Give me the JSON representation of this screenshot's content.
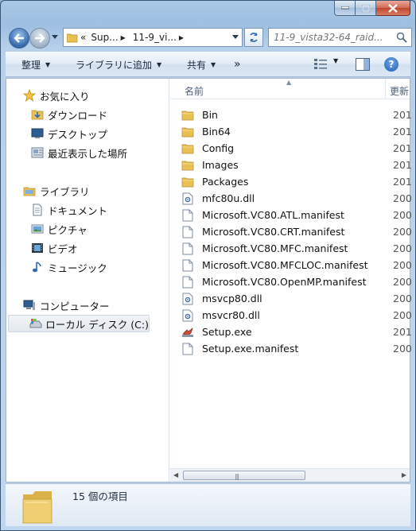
{
  "window": {
    "caption": {
      "minimize": "minimize",
      "maximize": "maximize",
      "close": "close"
    }
  },
  "address": {
    "overflow": "«",
    "segments": [
      "Sup...",
      "11-9_vi..."
    ]
  },
  "search": {
    "placeholder": "11-9_vista32-64_raid..."
  },
  "toolbar": {
    "organize": "整理",
    "add_to_library": "ライブラリに追加",
    "share": "共有",
    "more": "»"
  },
  "navigation": {
    "favorites": {
      "label": "お気に入り",
      "items": [
        "ダウンロード",
        "デスクトップ",
        "最近表示した場所"
      ]
    },
    "libraries": {
      "label": "ライブラリ",
      "items": [
        "ドキュメント",
        "ピクチャ",
        "ビデオ",
        "ミュージック"
      ]
    },
    "computer": {
      "label": "コンピューター",
      "items": [
        "ローカル ディスク (C:)"
      ]
    }
  },
  "columns": {
    "name": "名前",
    "date": "更新"
  },
  "files": [
    {
      "name": "Bin",
      "type": "folder",
      "date": "201"
    },
    {
      "name": "Bin64",
      "type": "folder",
      "date": "201"
    },
    {
      "name": "Config",
      "type": "folder",
      "date": "201"
    },
    {
      "name": "Images",
      "type": "folder",
      "date": "201"
    },
    {
      "name": "Packages",
      "type": "folder",
      "date": "201"
    },
    {
      "name": "mfc80u.dll",
      "type": "dll",
      "date": "200"
    },
    {
      "name": "Microsoft.VC80.ATL.manifest",
      "type": "file",
      "date": "200"
    },
    {
      "name": "Microsoft.VC80.CRT.manifest",
      "type": "file",
      "date": "200"
    },
    {
      "name": "Microsoft.VC80.MFC.manifest",
      "type": "file",
      "date": "200"
    },
    {
      "name": "Microsoft.VC80.MFCLOC.manifest",
      "type": "file",
      "date": "200"
    },
    {
      "name": "Microsoft.VC80.OpenMP.manifest",
      "type": "file",
      "date": "200"
    },
    {
      "name": "msvcp80.dll",
      "type": "dll",
      "date": "200"
    },
    {
      "name": "msvcr80.dll",
      "type": "dll",
      "date": "200"
    },
    {
      "name": "Setup.exe",
      "type": "exe",
      "date": "201"
    },
    {
      "name": "Setup.exe.manifest",
      "type": "file",
      "date": "200"
    }
  ],
  "status": {
    "item_count": "15 個の項目"
  },
  "colors": {
    "accent": "#3569ad",
    "folder": "#e8c054",
    "selected": "#e4e9ef"
  }
}
